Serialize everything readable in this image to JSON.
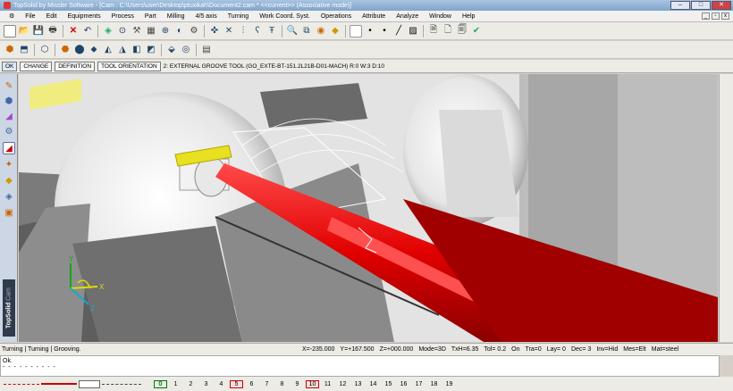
{
  "window": {
    "title": "TopSolid by Missler Software - [Cam : C:\\Users\\user\\Desktop\\ptuxikah\\Document2.cam *  <<current>> (Associative mode)]",
    "min": "–",
    "max": "□",
    "close": "✕"
  },
  "menu": [
    "File",
    "Edit",
    "Equipments",
    "Process",
    "Part",
    "Milling",
    "4/5 axis",
    "Turning",
    "Work Coord. Syst.",
    "Operations",
    "Attribute",
    "Analyze",
    "Window",
    "Help"
  ],
  "mdi": {
    "min": "_",
    "restore": "▫",
    "close": "x"
  },
  "cmd": {
    "ok": "OK",
    "change": "CHANGE",
    "definition": "DEFINITION",
    "orientation": "TOOL ORIENTATION",
    "tool_text": "2: EXTERNAL GROOVE TOOL (GO_EXTE-BT-151.2L21B-D01-MACH) R:0 W:3 D:10"
  },
  "side": {
    "brand": "TopSolid",
    "module": "Cam"
  },
  "status": {
    "mode": "Turning | Turning | Grooving.",
    "x": "X=-235.000",
    "y": "Y=+167.500",
    "z": "Z=+000.000",
    "m": "Mode=3D",
    "txh": "TxH=6.35",
    "tol": "Tol=  0.2",
    "on": "On",
    "tra": "Tra=0",
    "lay": "Lay=  0",
    "dec": "Dec= 3",
    "inv": "Inv=Hid",
    "mes": "Mes=Elt",
    "mat": "Mat=steel"
  },
  "messages": {
    "line1": "Ok.",
    "line2": "- - - - - - - - - -"
  },
  "layers": [
    "0",
    "1",
    "2",
    "3",
    "4",
    "5",
    "6",
    "7",
    "8",
    "9",
    "10",
    "11",
    "12",
    "13",
    "14",
    "15",
    "16",
    "17",
    "18",
    "19"
  ],
  "axes": {
    "x": "X",
    "y": "Y",
    "z": "Z"
  }
}
